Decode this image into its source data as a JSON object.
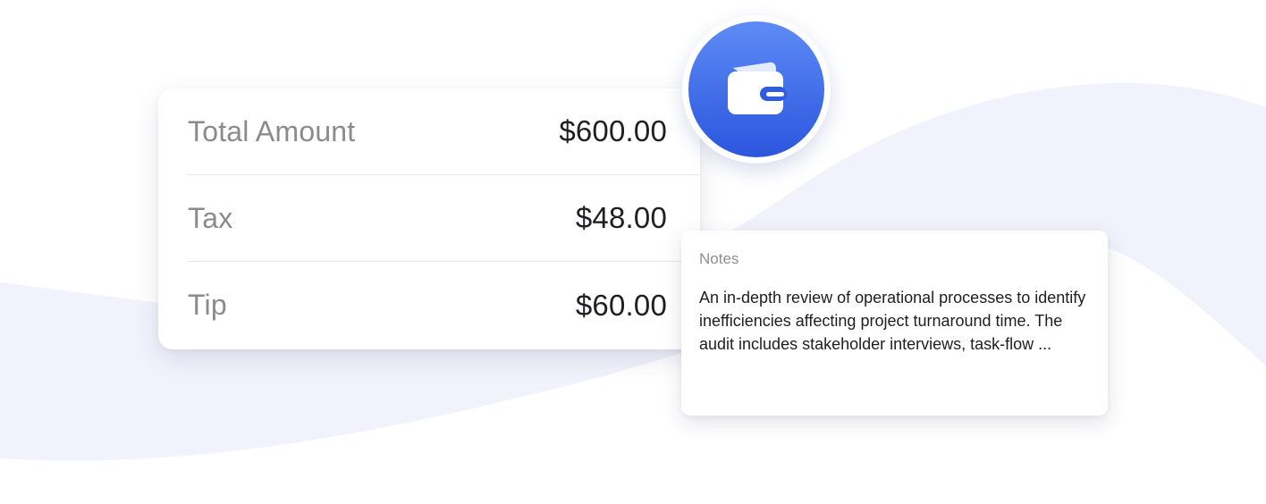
{
  "amounts": {
    "rows": [
      {
        "label": "Total Amount",
        "value": "$600.00"
      },
      {
        "label": "Tax",
        "value": "$48.00"
      },
      {
        "label": "Tip",
        "value": "$60.00"
      }
    ]
  },
  "wallet": {
    "icon": "wallet-icon",
    "color": "#2f5ce0"
  },
  "notes": {
    "title": "Notes",
    "body": "An in-depth review of operational processes to identify inefficiencies affecting project turnaround time. The audit includes stakeholder interviews, task-flow ..."
  },
  "colors": {
    "background_wave": "#f1f2fc",
    "accent": "#2f5ce0"
  }
}
